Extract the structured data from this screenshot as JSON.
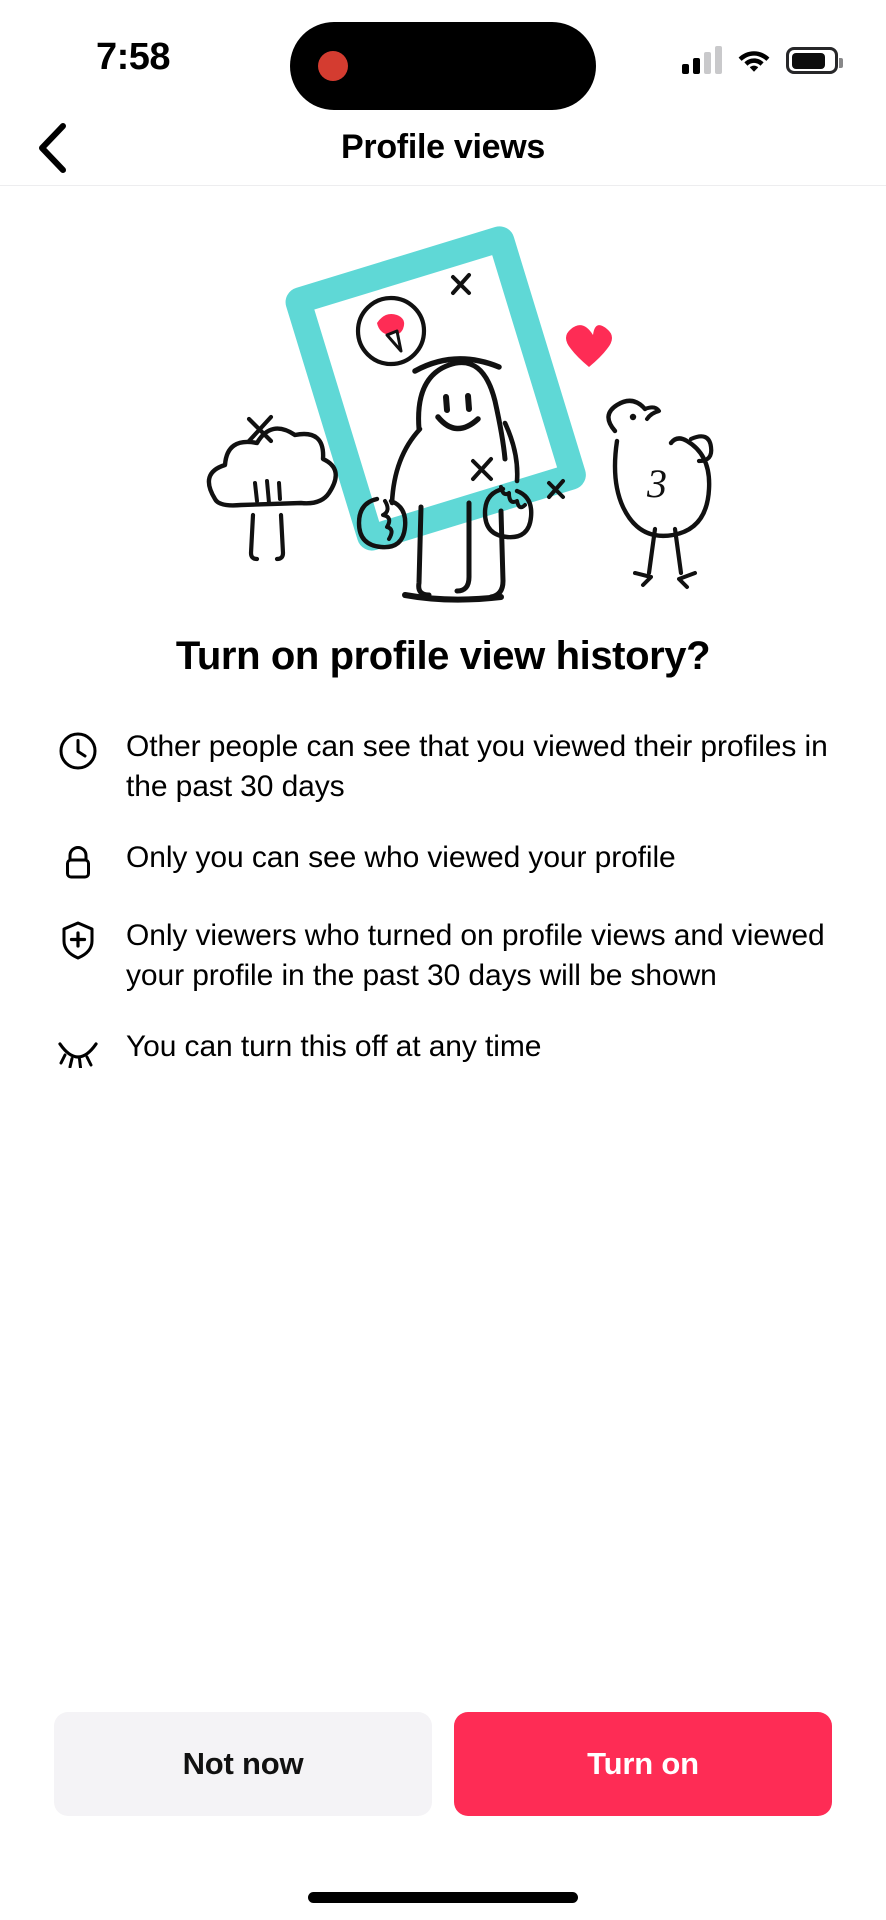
{
  "status_bar": {
    "time": "7:58",
    "signal_icon": "cellular-signal-icon",
    "signal_bars_filled": 2,
    "signal_bars_total": 4,
    "wifi_icon": "wifi-icon",
    "battery_icon": "battery-icon",
    "battery_level_percent": 72,
    "dynamic_island": "dynamic-island"
  },
  "header": {
    "back_icon": "chevron-left-icon",
    "title": "Profile views"
  },
  "hero": {
    "illustration_name": "person-holding-picture-frame-illustration",
    "frame_color": "#5FD8D6",
    "accent_color": "#FE2C55",
    "bird_label": "3"
  },
  "main": {
    "headline": "Turn on profile view history?",
    "bullets": [
      {
        "icon": "clock-icon",
        "text": "Other people can see that you viewed their profiles in the past 30 days"
      },
      {
        "icon": "lock-icon",
        "text": "Only you can see who viewed your profile"
      },
      {
        "icon": "shield-plus-icon",
        "text": "Only viewers who turned on profile views and viewed your profile in the past 30 days will be shown"
      },
      {
        "icon": "eye-off-icon",
        "text": "You can turn this off at any time"
      }
    ]
  },
  "footer": {
    "secondary_label": "Not now",
    "primary_label": "Turn on"
  },
  "colors": {
    "primary_red": "#FE2C55",
    "frame_teal": "#5FD8D6",
    "secondary_button_bg": "#F4F3F6",
    "background": "#FFFFFF"
  },
  "home_indicator": "home-indicator"
}
